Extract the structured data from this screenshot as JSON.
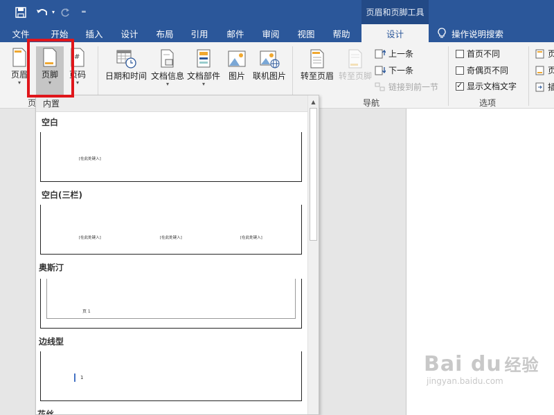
{
  "titlebar": {
    "tool_context": "页眉和页脚工具"
  },
  "tabs": [
    {
      "label": "文件"
    },
    {
      "label": "开始"
    },
    {
      "label": "插入"
    },
    {
      "label": "设计"
    },
    {
      "label": "布局"
    },
    {
      "label": "引用"
    },
    {
      "label": "邮件"
    },
    {
      "label": "审阅"
    },
    {
      "label": "视图"
    },
    {
      "label": "帮助"
    },
    {
      "label": "设计",
      "active": true
    }
  ],
  "tell_me": "操作说明搜索",
  "ribbon": {
    "header_btn": "页眉",
    "footer_btn": "页脚",
    "pagenum_btn": "页码",
    "group_hf_label_partial": "页",
    "datetime_btn": "日期和时间",
    "docinfo_btn": "文档信息",
    "docparts_btn": "文档部件",
    "picture_btn": "图片",
    "online_picture_btn": "联机图片",
    "goto_header_btn": "转至页眉",
    "goto_footer_btn": "转至页脚",
    "prev_btn": "上一条",
    "next_btn": "下一条",
    "link_prev_btn": "链接到前一节",
    "nav_group_label": "导航",
    "opt_first_page": "首页不同",
    "opt_odd_even": "奇偶页不同",
    "opt_show_text": "显示文档文字",
    "options_group_label": "选项",
    "pos_items": [
      "页",
      "页",
      "插"
    ]
  },
  "gallery": {
    "header": "内置",
    "items": [
      {
        "title": "空白",
        "placeholders": [
          "[在此处键入]"
        ]
      },
      {
        "title": "空白(三栏)",
        "placeholders": [
          "[在此处键入]",
          "[在此处键入]",
          "[在此处键入]"
        ]
      },
      {
        "title": "奥斯汀",
        "page_text": "页 1"
      },
      {
        "title": "边线型",
        "page_text": "1"
      },
      {
        "title": "花丝"
      }
    ]
  },
  "watermark": {
    "logo_text": "Bai du",
    "logo_cn": "经验",
    "url": "jingyan.baidu.com"
  },
  "colors": {
    "title_blue": "#2b579a",
    "highlight_red": "#e0161b"
  }
}
